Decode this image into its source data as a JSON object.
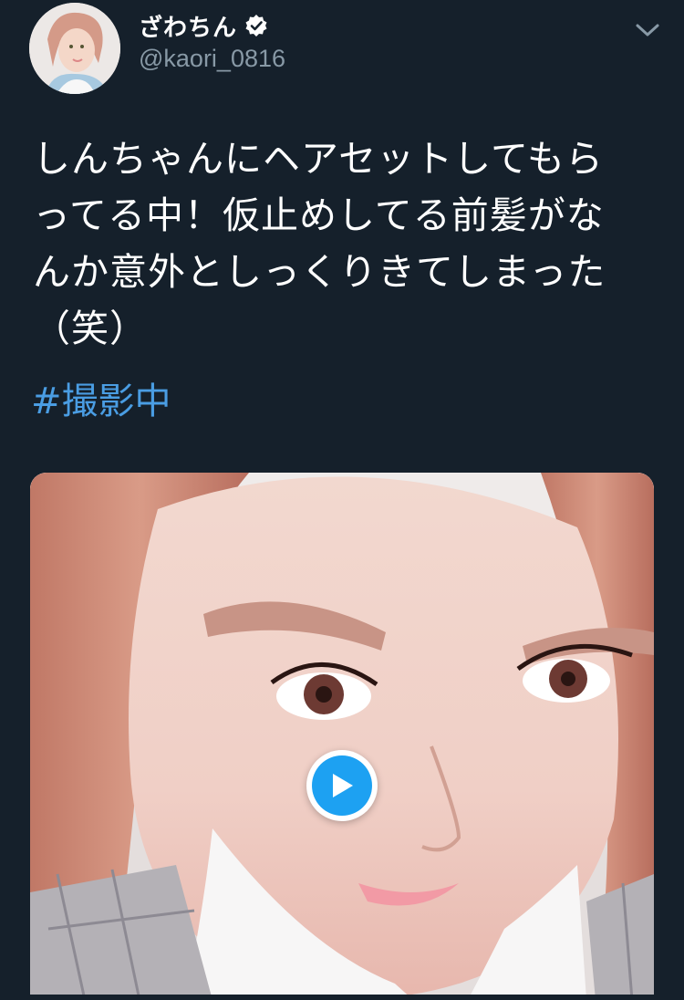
{
  "tweet": {
    "display_name": "ざわちん",
    "handle": "@kaori_0816",
    "verified": true,
    "text": "しんちゃんにヘアセットしてもら\nってる中！仮止めしてる前髪がな\nんか意外としっくりきてしまった\n（笑）",
    "hashtag": "#撮影中",
    "media_type": "video"
  },
  "colors": {
    "background": "#15202b",
    "text": "#ffffff",
    "secondary_text": "#8899a6",
    "link": "#4a9de3",
    "play_button": "#1da1f2"
  },
  "icons": {
    "verified": "verified-badge-icon",
    "menu": "chevron-down-icon",
    "play": "play-icon"
  }
}
